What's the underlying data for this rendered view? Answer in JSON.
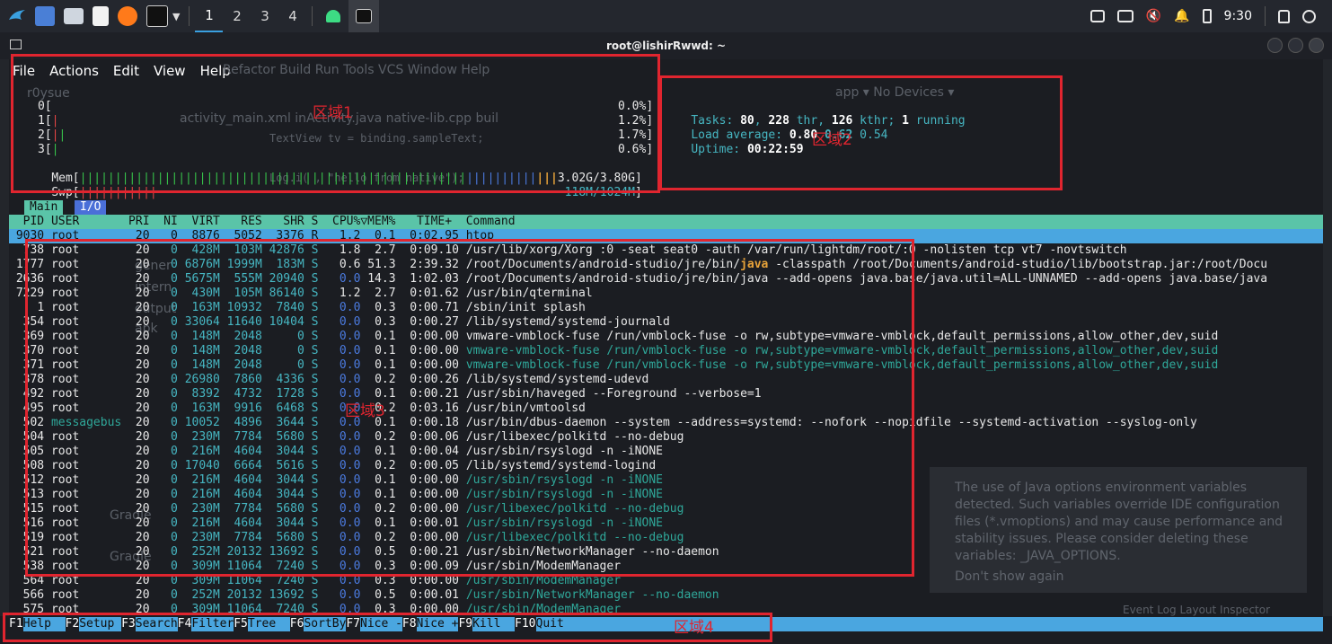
{
  "panel": {
    "workspaces": [
      "1",
      "2",
      "3",
      "4"
    ],
    "clock": "9:30"
  },
  "window": {
    "title": "root@lishirRwwd: ~",
    "menu": [
      "File",
      "Actions",
      "Edit",
      "View",
      "Help"
    ]
  },
  "ghost": {
    "ide_menu": "Refactor   Build   Run   Tools   VCS   Window   Help",
    "project": "r0ysue",
    "tabs": "activity_main.xml     inActivity.java     native-lib.cpp      buil",
    "code1": "TextView tv = binding.sampleText;",
    "code2": "Log.i(         ,  \"hello from native\");",
    "device": "app  ▾   No Devices ▾",
    "notice": "The use of Java options environment variables detected. Such variables override IDE configuration files (*.vmoptions) and may cause performance and stability issues. Please consider deleting these variables: _JAVA_OPTIONS.",
    "dont_show": "Don't show again",
    "status": "Event Log    Layout Inspector",
    "side_items": [
      "gener",
      "intern",
      "output",
      "apk"
    ],
    "gradle": [
      "Gradle",
      "Gradle"
    ]
  },
  "htop": {
    "cpus": [
      {
        "id": "0",
        "pct": "0.0%"
      },
      {
        "id": "1",
        "pct": "1.2%"
      },
      {
        "id": "2",
        "pct": "1.7%"
      },
      {
        "id": "3",
        "pct": "0.6%"
      }
    ],
    "mem": {
      "label": "Mem",
      "value": "3.02G/3.80G"
    },
    "swp": {
      "label": "Swp",
      "value": "118M/1024M"
    },
    "tasks": {
      "label": "Tasks: ",
      "count": "80",
      "thr": "228",
      "thr_label": " thr, ",
      "kthr": "126",
      "kthr_label": " kthr; ",
      "running": "1",
      "running_label": " running"
    },
    "load": {
      "label": "Load average: ",
      "l1": "0.80",
      "l5": "0.62",
      "l15": "0.54"
    },
    "uptime": {
      "label": "Uptime: ",
      "value": "00:22:59"
    },
    "tabs": [
      "Main",
      "I/O"
    ],
    "header": "  PID USER       PRI  NI  VIRT   RES   SHR S  CPU%▽MEM%   TIME+  Command",
    "selected": " 9030 root        20   0  8876  5052  3376 R   1.2  0.1  0:02.95 htop",
    "rows": [
      {
        "pid": "738",
        "user": "root",
        "pri": "20",
        "ni": "0",
        "virt": "428M",
        "res": "103M",
        "shr": "42876",
        "s": "S",
        "cpu": "1.8",
        "mem": "2.7",
        "time": "0:09.10",
        "cmd": "/usr/lib/xorg/Xorg :0 -seat seat0 -auth /var/run/lightdm/root/:0 -nolisten tcp vt7 -novtswitch",
        "thread": false
      },
      {
        "pid": "1777",
        "user": "root",
        "pri": "20",
        "ni": "0",
        "virt": "6876M",
        "res": "1999M",
        "shr": "183M",
        "s": "S",
        "cpu": "0.6",
        "mem": "51.3",
        "time": "2:39.32",
        "cmd": "/root/Documents/android-studio/jre/bin/java -classpath /root/Documents/android-studio/lib/bootstrap.jar:/root/Docu",
        "thread": false,
        "java": true
      },
      {
        "pid": "2636",
        "user": "root",
        "pri": "20",
        "ni": "0",
        "virt": "5675M",
        "res": "555M",
        "shr": "20940",
        "s": "S",
        "cpu": "0.0",
        "mem": "14.3",
        "time": "1:02.03",
        "cmd": "/root/Documents/android-studio/jre/bin/java --add-opens java.base/java.util=ALL-UNNAMED --add-opens java.base/java",
        "thread": false
      },
      {
        "pid": "7229",
        "user": "root",
        "pri": "20",
        "ni": "0",
        "virt": "430M",
        "res": "105M",
        "shr": "86140",
        "s": "S",
        "cpu": "1.2",
        "mem": "2.7",
        "time": "0:01.62",
        "cmd": "/usr/bin/qterminal",
        "thread": false
      },
      {
        "pid": "1",
        "user": "root",
        "pri": "20",
        "ni": "0",
        "virt": "163M",
        "res": "10932",
        "shr": "7840",
        "s": "S",
        "cpu": "0.0",
        "mem": "0.3",
        "time": "0:00.71",
        "cmd": "/sbin/init splash",
        "thread": false
      },
      {
        "pid": "354",
        "user": "root",
        "pri": "20",
        "ni": "0",
        "virt": "33064",
        "res": "11640",
        "shr": "10404",
        "s": "S",
        "cpu": "0.0",
        "mem": "0.3",
        "time": "0:00.27",
        "cmd": "/lib/systemd/systemd-journald",
        "thread": false
      },
      {
        "pid": "369",
        "user": "root",
        "pri": "20",
        "ni": "0",
        "virt": "148M",
        "res": "2048",
        "shr": "0",
        "s": "S",
        "cpu": "0.0",
        "mem": "0.1",
        "time": "0:00.00",
        "cmd": "vmware-vmblock-fuse /run/vmblock-fuse -o rw,subtype=vmware-vmblock,default_permissions,allow_other,dev,suid",
        "thread": false
      },
      {
        "pid": "370",
        "user": "root",
        "pri": "20",
        "ni": "0",
        "virt": "148M",
        "res": "2048",
        "shr": "0",
        "s": "S",
        "cpu": "0.0",
        "mem": "0.1",
        "time": "0:00.00",
        "cmd": "vmware-vmblock-fuse /run/vmblock-fuse -o rw,subtype=vmware-vmblock,default_permissions,allow_other,dev,suid",
        "thread": true
      },
      {
        "pid": "371",
        "user": "root",
        "pri": "20",
        "ni": "0",
        "virt": "148M",
        "res": "2048",
        "shr": "0",
        "s": "S",
        "cpu": "0.0",
        "mem": "0.1",
        "time": "0:00.00",
        "cmd": "vmware-vmblock-fuse /run/vmblock-fuse -o rw,subtype=vmware-vmblock,default_permissions,allow_other,dev,suid",
        "thread": true
      },
      {
        "pid": "378",
        "user": "root",
        "pri": "20",
        "ni": "0",
        "virt": "26980",
        "res": "7860",
        "shr": "4336",
        "s": "S",
        "cpu": "0.0",
        "mem": "0.2",
        "time": "0:00.26",
        "cmd": "/lib/systemd/systemd-udevd",
        "thread": false
      },
      {
        "pid": "492",
        "user": "root",
        "pri": "20",
        "ni": "0",
        "virt": "8392",
        "res": "4732",
        "shr": "1728",
        "s": "S",
        "cpu": "0.0",
        "mem": "0.1",
        "time": "0:00.21",
        "cmd": "/usr/sbin/haveged --Foreground --verbose=1",
        "thread": false
      },
      {
        "pid": "495",
        "user": "root",
        "pri": "20",
        "ni": "0",
        "virt": "163M",
        "res": "9916",
        "shr": "6468",
        "s": "S",
        "cpu": "0.0",
        "mem": "0.2",
        "time": "0:03.16",
        "cmd": "/usr/bin/vmtoolsd",
        "thread": false
      },
      {
        "pid": "502",
        "user": "messagebus",
        "pri": "20",
        "ni": "0",
        "virt": "10052",
        "res": "4896",
        "shr": "3644",
        "s": "S",
        "cpu": "0.0",
        "mem": "0.1",
        "time": "0:00.18",
        "cmd": "/usr/bin/dbus-daemon --system --address=systemd: --nofork --nopidfile --systemd-activation --syslog-only",
        "thread": false,
        "special_user": true
      },
      {
        "pid": "504",
        "user": "root",
        "pri": "20",
        "ni": "0",
        "virt": "230M",
        "res": "7784",
        "shr": "5680",
        "s": "S",
        "cpu": "0.0",
        "mem": "0.2",
        "time": "0:00.06",
        "cmd": "/usr/libexec/polkitd --no-debug",
        "thread": false
      },
      {
        "pid": "505",
        "user": "root",
        "pri": "20",
        "ni": "0",
        "virt": "216M",
        "res": "4604",
        "shr": "3044",
        "s": "S",
        "cpu": "0.0",
        "mem": "0.1",
        "time": "0:00.04",
        "cmd": "/usr/sbin/rsyslogd -n -iNONE",
        "thread": false
      },
      {
        "pid": "508",
        "user": "root",
        "pri": "20",
        "ni": "0",
        "virt": "17040",
        "res": "6664",
        "shr": "5616",
        "s": "S",
        "cpu": "0.0",
        "mem": "0.2",
        "time": "0:00.05",
        "cmd": "/lib/systemd/systemd-logind",
        "thread": false
      },
      {
        "pid": "512",
        "user": "root",
        "pri": "20",
        "ni": "0",
        "virt": "216M",
        "res": "4604",
        "shr": "3044",
        "s": "S",
        "cpu": "0.0",
        "mem": "0.1",
        "time": "0:00.00",
        "cmd": "/usr/sbin/rsyslogd -n -iNONE",
        "thread": true
      },
      {
        "pid": "513",
        "user": "root",
        "pri": "20",
        "ni": "0",
        "virt": "216M",
        "res": "4604",
        "shr": "3044",
        "s": "S",
        "cpu": "0.0",
        "mem": "0.1",
        "time": "0:00.00",
        "cmd": "/usr/sbin/rsyslogd -n -iNONE",
        "thread": true
      },
      {
        "pid": "515",
        "user": "root",
        "pri": "20",
        "ni": "0",
        "virt": "230M",
        "res": "7784",
        "shr": "5680",
        "s": "S",
        "cpu": "0.0",
        "mem": "0.2",
        "time": "0:00.00",
        "cmd": "/usr/libexec/polkitd --no-debug",
        "thread": true
      },
      {
        "pid": "516",
        "user": "root",
        "pri": "20",
        "ni": "0",
        "virt": "216M",
        "res": "4604",
        "shr": "3044",
        "s": "S",
        "cpu": "0.0",
        "mem": "0.1",
        "time": "0:00.01",
        "cmd": "/usr/sbin/rsyslogd -n -iNONE",
        "thread": true
      },
      {
        "pid": "519",
        "user": "root",
        "pri": "20",
        "ni": "0",
        "virt": "230M",
        "res": "7784",
        "shr": "5680",
        "s": "S",
        "cpu": "0.0",
        "mem": "0.2",
        "time": "0:00.00",
        "cmd": "/usr/libexec/polkitd --no-debug",
        "thread": true
      },
      {
        "pid": "521",
        "user": "root",
        "pri": "20",
        "ni": "0",
        "virt": "252M",
        "res": "20132",
        "shr": "13692",
        "s": "S",
        "cpu": "0.0",
        "mem": "0.5",
        "time": "0:00.21",
        "cmd": "/usr/sbin/NetworkManager --no-daemon",
        "thread": false
      },
      {
        "pid": "538",
        "user": "root",
        "pri": "20",
        "ni": "0",
        "virt": "309M",
        "res": "11064",
        "shr": "7240",
        "s": "S",
        "cpu": "0.0",
        "mem": "0.3",
        "time": "0:00.09",
        "cmd": "/usr/sbin/ModemManager",
        "thread": false
      },
      {
        "pid": "564",
        "user": "root",
        "pri": "20",
        "ni": "0",
        "virt": "309M",
        "res": "11064",
        "shr": "7240",
        "s": "S",
        "cpu": "0.0",
        "mem": "0.3",
        "time": "0:00.00",
        "cmd": "/usr/sbin/ModemManager",
        "thread": true
      },
      {
        "pid": "566",
        "user": "root",
        "pri": "20",
        "ni": "0",
        "virt": "252M",
        "res": "20132",
        "shr": "13692",
        "s": "S",
        "cpu": "0.0",
        "mem": "0.5",
        "time": "0:00.01",
        "cmd": "/usr/sbin/NetworkManager --no-daemon",
        "thread": true
      },
      {
        "pid": "575",
        "user": "root",
        "pri": "20",
        "ni": "0",
        "virt": "309M",
        "res": "11064",
        "shr": "7240",
        "s": "S",
        "cpu": "0.0",
        "mem": "0.3",
        "time": "0:00.00",
        "cmd": "/usr/sbin/ModemManager",
        "thread": true
      }
    ],
    "fkeys": [
      {
        "key": "F1",
        "label": "Help"
      },
      {
        "key": "F2",
        "label": "Setup"
      },
      {
        "key": "F3",
        "label": "Search"
      },
      {
        "key": "F4",
        "label": "Filter"
      },
      {
        "key": "F5",
        "label": "Tree"
      },
      {
        "key": "F6",
        "label": "SortBy"
      },
      {
        "key": "F7",
        "label": "Nice -"
      },
      {
        "key": "F8",
        "label": "Nice +"
      },
      {
        "key": "F9",
        "label": "Kill"
      },
      {
        "key": "F10",
        "label": "Quit"
      }
    ]
  },
  "annotations": {
    "region1": "区域1",
    "region2": "区域2",
    "region3": "区域3",
    "region4": "区域4"
  },
  "colors": {
    "annotation_red": "#e0252f",
    "header_green": "#5ac4a8",
    "selection_blue": "#4aa6e0"
  }
}
